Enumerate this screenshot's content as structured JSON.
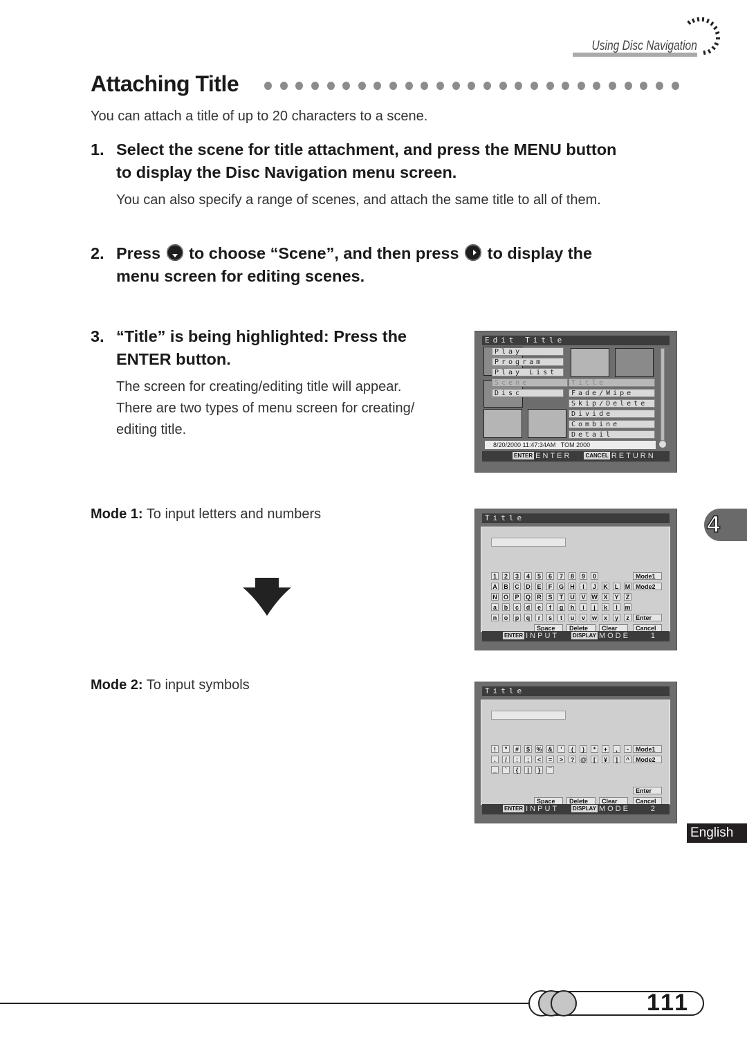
{
  "header": {
    "section": "Using Disc Navigation"
  },
  "title": "Attaching Title",
  "intro": "You can attach a title of up to 20 characters to a scene.",
  "steps": [
    {
      "num": "1.",
      "line1": "Select the scene for title attachment, and press the MENU button",
      "line2": "to display the Disc Navigation menu screen.",
      "note": "You can also specify a range of scenes, and attach the same title to all of them."
    },
    {
      "num": "2.",
      "part1": "Press",
      "part2": "to choose “Scene”, and then press",
      "part3": "to display the",
      "line2": "menu screen for editing scenes.",
      "icon1": "down-button-icon",
      "icon2": "right-button-icon"
    },
    {
      "num": "3.",
      "line1": "“Title” is being highlighted: Press the",
      "line2": "ENTER button.",
      "note_lines": [
        "The screen for creating/editing title will appear.",
        "There are two types of menu screen for creating/",
        "editing title."
      ]
    }
  ],
  "modes": [
    {
      "label": "Mode 1:",
      "desc": "To input letters and numbers"
    },
    {
      "label": "Mode 2:",
      "desc": "To input symbols"
    }
  ],
  "screen_edit": {
    "title": "Edit Title",
    "left_menu": [
      "Play",
      "Program",
      "Play List",
      "Scene",
      "Disc"
    ],
    "highlighted_left": "Scene",
    "sub_menu": [
      "Title",
      "Fade/Wipe",
      "Skip/Delete",
      "Divide",
      "Combine",
      "Detail"
    ],
    "highlighted_sub": "Title",
    "status": "8/20/2000 11:47:34AM   TOM 2000",
    "footer": [
      {
        "tag": "ENTER",
        "label": "ENTER"
      },
      {
        "tag": "CANCEL",
        "label": "RETURN"
      }
    ]
  },
  "screen_mode1": {
    "title": "Title",
    "rows": [
      [
        "1",
        "2",
        "3",
        "4",
        "5",
        "6",
        "7",
        "8",
        "9",
        "0"
      ],
      [
        "A",
        "B",
        "C",
        "D",
        "E",
        "F",
        "G",
        "H",
        "I",
        "J",
        "K",
        "L",
        "M"
      ],
      [
        "N",
        "O",
        "P",
        "Q",
        "R",
        "S",
        "T",
        "U",
        "V",
        "W",
        "X",
        "Y",
        "Z"
      ],
      [
        "a",
        "b",
        "c",
        "d",
        "e",
        "f",
        "g",
        "h",
        "i",
        "j",
        "k",
        "l",
        "m"
      ],
      [
        "n",
        "o",
        "p",
        "q",
        "r",
        "s",
        "t",
        "u",
        "v",
        "w",
        "x",
        "y",
        "z"
      ]
    ],
    "side_buttons": [
      "Mode1",
      "Mode2",
      "Enter",
      "Cancel"
    ],
    "bottom_buttons": [
      "Space",
      "Delete",
      "Clear"
    ],
    "footer": [
      {
        "tag": "ENTER",
        "label": "INPUT"
      },
      {
        "tag": "DISPLAY",
        "label": "MODE"
      }
    ],
    "mode_number": "1"
  },
  "screen_mode2": {
    "title": "Title",
    "rows": [
      [
        "!",
        "\"",
        "#",
        "$",
        "%",
        "&",
        "'",
        "(",
        ")",
        "*",
        "+",
        ",",
        "-"
      ],
      [
        ".",
        "/",
        ":",
        ";",
        "<",
        "=",
        ">",
        "?",
        "@",
        "[",
        "¥",
        "]",
        "^"
      ],
      [
        "_",
        "`",
        "{",
        "|",
        "}",
        "¯"
      ]
    ],
    "side_buttons": [
      "Mode1",
      "Mode2",
      "Enter",
      "Cancel"
    ],
    "bottom_buttons": [
      "Space",
      "Delete",
      "Clear"
    ],
    "footer": [
      {
        "tag": "ENTER",
        "label": "INPUT"
      },
      {
        "tag": "DISPLAY",
        "label": "MODE"
      }
    ],
    "mode_number": "2"
  },
  "chapter_tab": "4",
  "language_tab": "English",
  "page_number": "111"
}
